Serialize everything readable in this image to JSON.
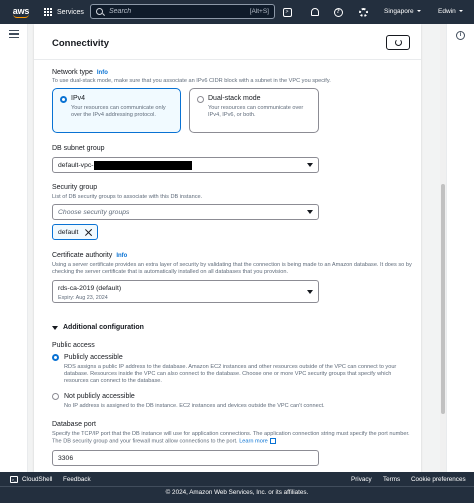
{
  "topnav": {
    "logo_text": "aws",
    "services_label": "Services",
    "search_placeholder": "Search",
    "search_shortcut": "[Alt+S]",
    "region": "Singapore",
    "user": "Edwin"
  },
  "panel": {
    "title": "Connectivity",
    "network_type": {
      "label": "Network type",
      "info": "Info",
      "description": "To use dual-stack mode, make sure that you associate an IPv6 CIDR block with a subnet in the VPC you specify.",
      "options": [
        {
          "title": "IPv4",
          "description": "Your resources can communicate only over the IPv4 addressing protocol.",
          "selected": true
        },
        {
          "title": "Dual-stack mode",
          "description": "Your resources can communicate over IPv4, IPv6, or both.",
          "selected": false
        }
      ]
    },
    "subnet_group": {
      "label": "DB subnet group",
      "value": "default-vpc-"
    },
    "security_group": {
      "label": "Security group",
      "description": "List of DB security groups to associate with this DB instance.",
      "placeholder": "Choose security groups",
      "token": "default"
    },
    "certificate": {
      "label": "Certificate authority",
      "info": "Info",
      "description": "Using a server certificate provides an extra layer of security by validating that the connection is being made to an Amazon database. It does so by checking the server certificate that is automatically installed on all databases that you provision.",
      "value": "rds-ca-2019 (default)",
      "expiry": "Expiry: Aug 23, 2024"
    },
    "additional": {
      "title": "Additional configuration",
      "public_access_label": "Public access",
      "options": [
        {
          "title": "Publicly accessible",
          "description": "RDS assigns a public IP address to the database. Amazon EC2 instances and other resources outside of the VPC can connect to your database. Resources inside the VPC can also connect to the database. Choose one or more VPC security groups that specify which resources can connect to the database.",
          "selected": true
        },
        {
          "title": "Not publicly accessible",
          "description": "No IP address is assigned to the DB instance. EC2 instances and devices outside the VPC can't connect.",
          "selected": false
        }
      ],
      "port_label": "Database port",
      "port_description": "Specify the TCP/IP port that the DB instance will use for application connections. The application connection string must specify the port number. The DB security group and your firewall must allow connections to the port.",
      "learn_more": "Learn more",
      "port_value": "3306"
    }
  },
  "footer": {
    "cloudshell": "CloudShell",
    "feedback": "Feedback",
    "privacy": "Privacy",
    "terms": "Terms",
    "cookie": "Cookie preferences",
    "copyright": "© 2024, Amazon Web Services, Inc. or its affiliates."
  },
  "colors": {
    "nav_bg": "#232f3e",
    "accent": "#0972d3",
    "logo_smile": "#ff9900"
  }
}
